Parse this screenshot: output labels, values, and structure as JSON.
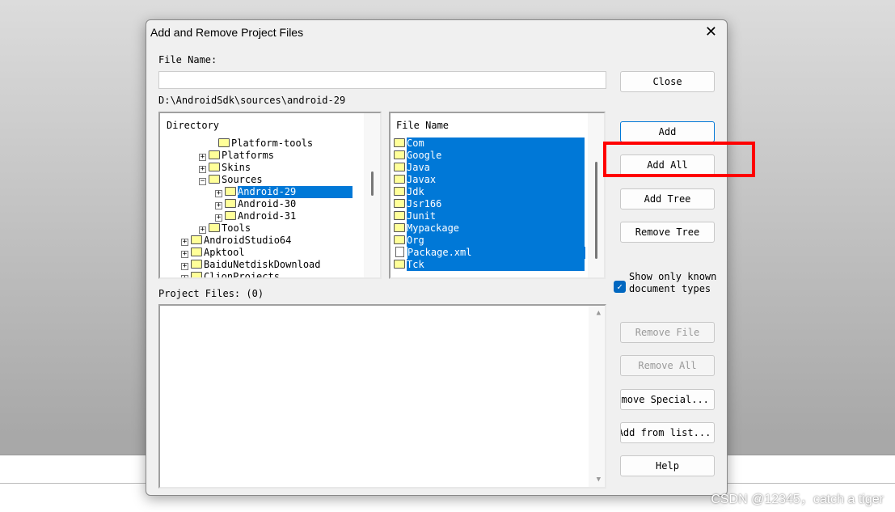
{
  "dialog": {
    "title": "Add and Remove Project Files",
    "close": "✕"
  },
  "file_name_label": "File Name:",
  "file_name_value": "",
  "path": "D:\\AndroidSdk\\sources\\android-29",
  "directory": {
    "header": "Directory",
    "items": [
      {
        "label": "Platform-tools",
        "toggle": ""
      },
      {
        "label": "Platforms",
        "toggle": "+"
      },
      {
        "label": "Skins",
        "toggle": "+"
      },
      {
        "label": "Sources",
        "toggle": "−"
      },
      {
        "label": "Android-29",
        "toggle": "+"
      },
      {
        "label": "Android-30",
        "toggle": "+"
      },
      {
        "label": "Android-31",
        "toggle": "+"
      },
      {
        "label": "Tools",
        "toggle": "+"
      },
      {
        "label": "AndroidStudio64",
        "toggle": "+"
      },
      {
        "label": "Apktool",
        "toggle": "+"
      },
      {
        "label": "BaiduNetdiskDownload",
        "toggle": "+"
      },
      {
        "label": "ClionProjects",
        "toggle": "+"
      }
    ]
  },
  "files": {
    "header": "File Name",
    "items": [
      "Com",
      "Google",
      "Java",
      "Javax",
      "Jdk",
      "Jsr166",
      "Junit",
      "Mypackage",
      "Org",
      "Package.xml",
      "Tck"
    ]
  },
  "project_files_label": "Project Files: (0)",
  "buttons": {
    "close": "Close",
    "add": "Add",
    "add_all": "Add All",
    "add_tree": "Add Tree",
    "remove_tree": "Remove Tree",
    "remove_file": "Remove File",
    "remove_all": "Remove All",
    "remove_special": "Remove Special...",
    "add_from_list": "Add from list...",
    "help": "Help"
  },
  "show_only": {
    "label": "Show only known document types",
    "checked": true
  },
  "watermark": "CSDN @12345，catch a tiger",
  "colors": {
    "selection": "#0078d7",
    "highlight": "#ff0000"
  }
}
